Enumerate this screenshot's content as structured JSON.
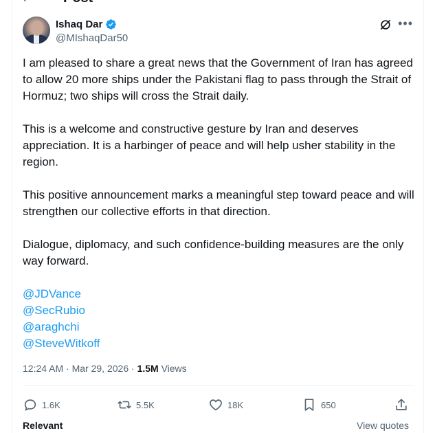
{
  "page": {
    "title": "Post"
  },
  "author": {
    "name": "Ishaq Dar",
    "handle": "@MIshaqDar50"
  },
  "post": {
    "paragraphs": [
      "I am pleased to share a great news that the Government of Iran has agreed to allow 20 more ships under the Pakistani flag to pass through the Strait of Hormuz; two ships will cross the Strait daily.",
      "This is a welcome and constructive gesture by Iran and deserves appreciation. It is a harbinger of peace and will help usher stability in the region.",
      "This positive announcement marks a meaningful step toward peace and will strengthen our collective efforts in that direction.",
      "Dialogue, diplomacy, and such confidence-building measures are the only way forward."
    ],
    "mentions": [
      "@JDVance",
      "@SecRubio",
      "@araghchi",
      "@SteveWitkoff"
    ],
    "time": "12:24 AM",
    "date": "Mar 29, 2026",
    "views_count": "1.5M",
    "views_label": "Views"
  },
  "stats": {
    "replies": "1.6K",
    "reposts": "5.5K",
    "likes": "18K",
    "bookmarks": "650"
  },
  "footer": {
    "relevant_label": "Relevant",
    "quotes_label": "View quotes"
  },
  "colors": {
    "accent": "#1d9bf0",
    "text": "#0f1419",
    "muted": "#536471"
  },
  "icons": {
    "verified": "verified-badge-icon",
    "grok": "grok-icon",
    "more": "more-icon",
    "reply": "reply-icon",
    "repost": "repost-icon",
    "like": "heart-icon",
    "bookmark": "bookmark-icon",
    "share": "share-icon"
  }
}
